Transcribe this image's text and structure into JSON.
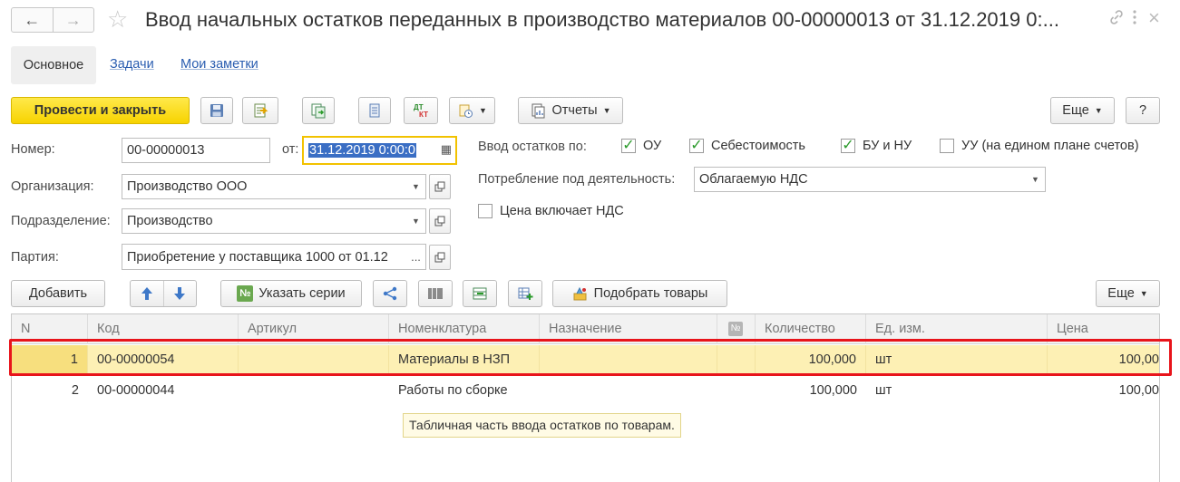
{
  "window": {
    "title": "Ввод начальных остатков переданных в производство материалов 00-00000013 от 31.12.2019 0:..."
  },
  "tabs": [
    {
      "label": "Основное"
    },
    {
      "label": "Задачи"
    },
    {
      "label": "Мои заметки"
    }
  ],
  "toolbar": {
    "post_close_label": "Провести и закрыть",
    "reports_label": "Отчеты",
    "more_label": "Еще",
    "help_label": "?"
  },
  "form": {
    "number_label": "Номер:",
    "number_value": "00-00000013",
    "date_label": "от:",
    "date_value": "31.12.2019  0:00:0",
    "organization_label": "Организация:",
    "organization_value": "Производство ООО",
    "department_label": "Подразделение:",
    "department_value": "Производство",
    "batch_label": "Партия:",
    "batch_value": "Приобретение у поставщика 1000 от 01.12",
    "batch_button": "...",
    "input_balances_label": "Ввод остатков по:",
    "checks": [
      {
        "label": "ОУ",
        "checked": true
      },
      {
        "label": "Себестоимость",
        "checked": true
      },
      {
        "label": "БУ и НУ",
        "checked": true
      },
      {
        "label": "УУ (на едином плане счетов)",
        "checked": false
      }
    ],
    "consumption_label": "Потребление под деятельность:",
    "consumption_value": "Облагаемую НДС",
    "vat_included_label": "Цена включает НДС",
    "vat_included_checked": false
  },
  "table_toolbar": {
    "add_label": "Добавить",
    "series_label": "Указать серии",
    "series_icon_text": "№",
    "pick_goods_label": "Подобрать товары",
    "more_label": "Еще"
  },
  "table": {
    "columns": [
      "N",
      "Код",
      "Артикул",
      "Номенклатура",
      "Назначение",
      "№",
      "Количество",
      "Ед. изм.",
      "Цена"
    ],
    "rows": [
      {
        "n": "1",
        "code": "00-00000054",
        "article": "",
        "item": "Материалы в НЗП",
        "purpose": "",
        "qty": "100,000",
        "unit": "шт",
        "price": "100,00"
      },
      {
        "n": "2",
        "code": "00-00000044",
        "article": "",
        "item": "Работы по сборке",
        "purpose": "",
        "qty": "100,000",
        "unit": "шт",
        "price": "100,00"
      }
    ],
    "hint": "Табличная часть ввода остатков по товарам."
  },
  "colors": {
    "primary_button": "#f7d300",
    "selected_row": "#fdf0b4",
    "highlight_frame": "#e8141b",
    "link": "#2a5db0",
    "check": "#2a9a2a"
  }
}
